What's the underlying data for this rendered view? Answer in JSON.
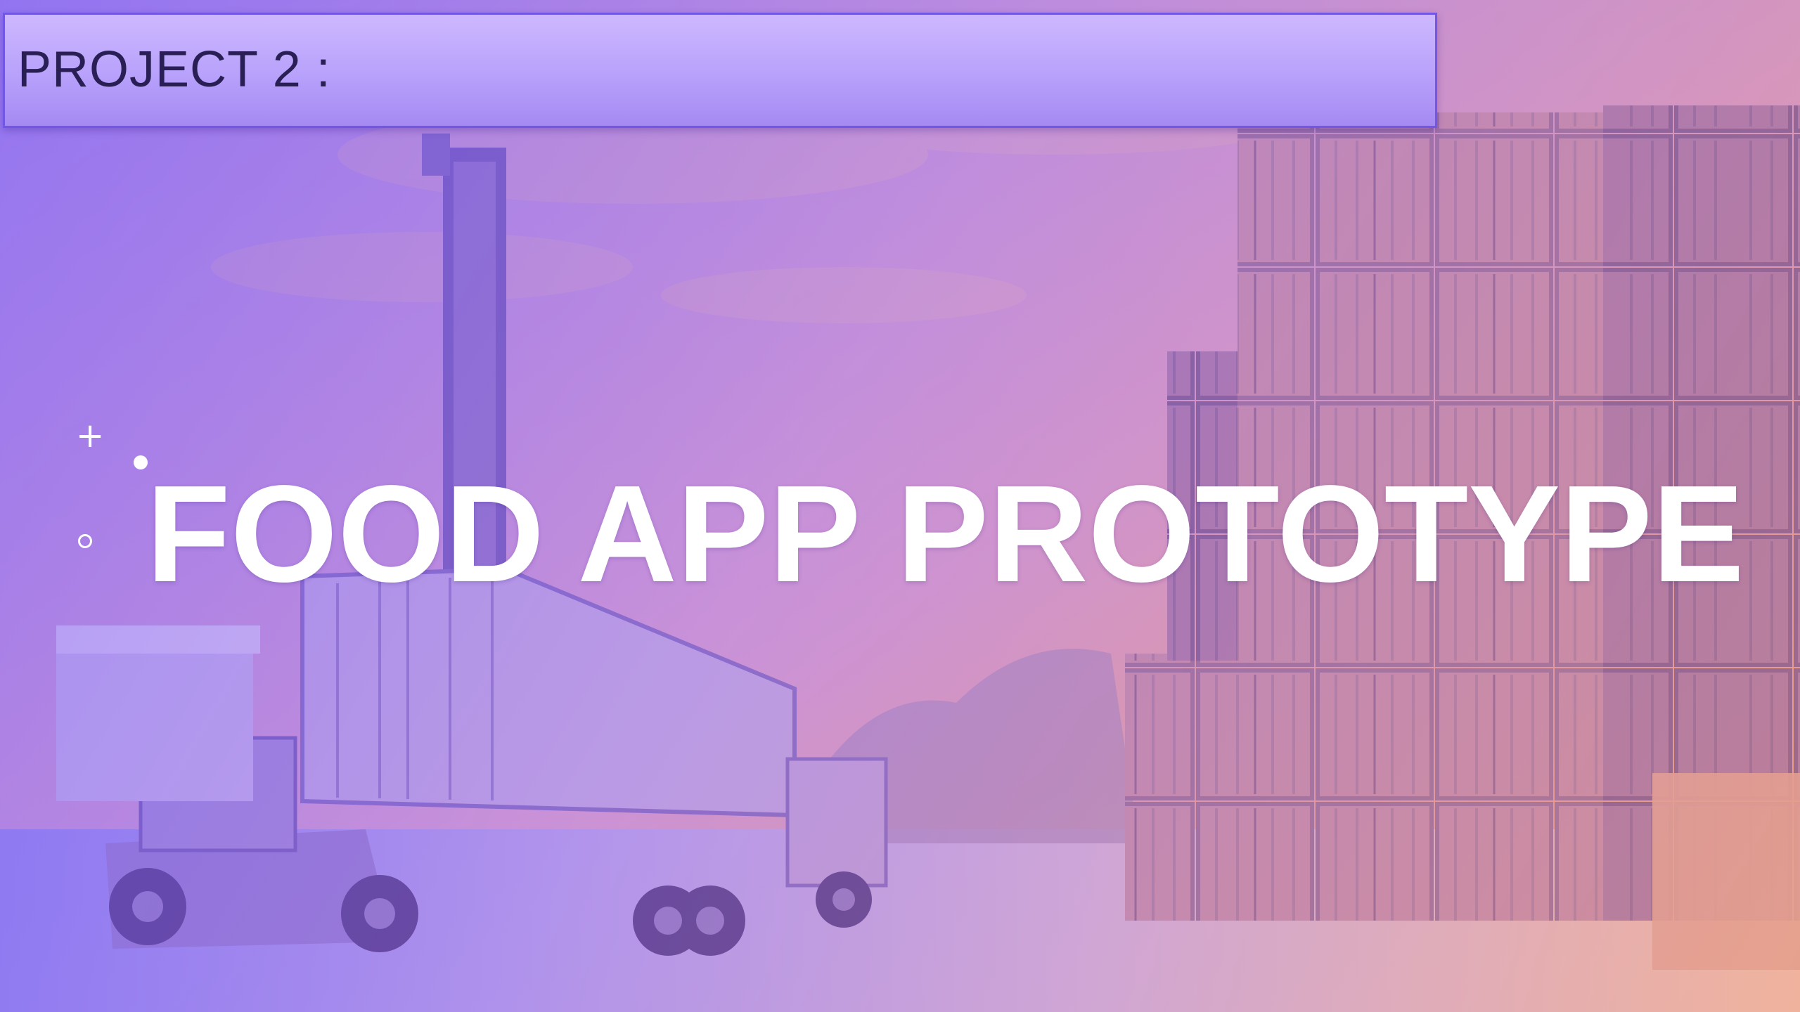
{
  "slide": {
    "title_bar": {
      "label": "PROJECT 2 :"
    },
    "heading": "FOOD APP PROTOTYPE",
    "background": {
      "description_icon": "shipping-container-yard-photo",
      "colors": {
        "tint_start": "#7a5cff",
        "tint_end": "#f0a070",
        "title_bar_fill": "#b9a3fb",
        "title_bar_border": "#7257e6",
        "title_text": "#2a1f55",
        "heading_text": "#ffffff"
      }
    },
    "decorations": {
      "plus": "+",
      "dot_icon": "dot-icon",
      "ring_icon": "ring-icon"
    }
  }
}
